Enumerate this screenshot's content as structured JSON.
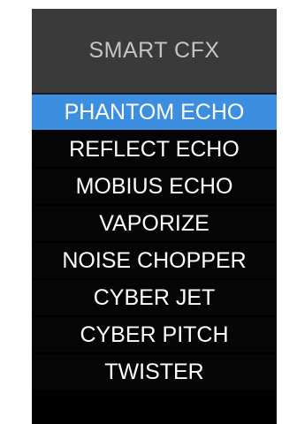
{
  "header": {
    "title": "SMART CFX"
  },
  "menu": {
    "selected_index": 0,
    "items": [
      {
        "label": "PHANTOM ECHO",
        "selected": true
      },
      {
        "label": "REFLECT ECHO",
        "selected": false
      },
      {
        "label": "MOBIUS ECHO",
        "selected": false
      },
      {
        "label": "VAPORIZE",
        "selected": false
      },
      {
        "label": "NOISE CHOPPER",
        "selected": false
      },
      {
        "label": "CYBER JET",
        "selected": false
      },
      {
        "label": "CYBER PITCH",
        "selected": false
      },
      {
        "label": "TWISTER",
        "selected": false
      }
    ]
  },
  "colors": {
    "header_bg": "#3a3a3a",
    "header_text": "#c4c4c4",
    "list_bg": "#000000",
    "item_text": "#ffffff",
    "selected_bg": "#3c8ee0"
  }
}
